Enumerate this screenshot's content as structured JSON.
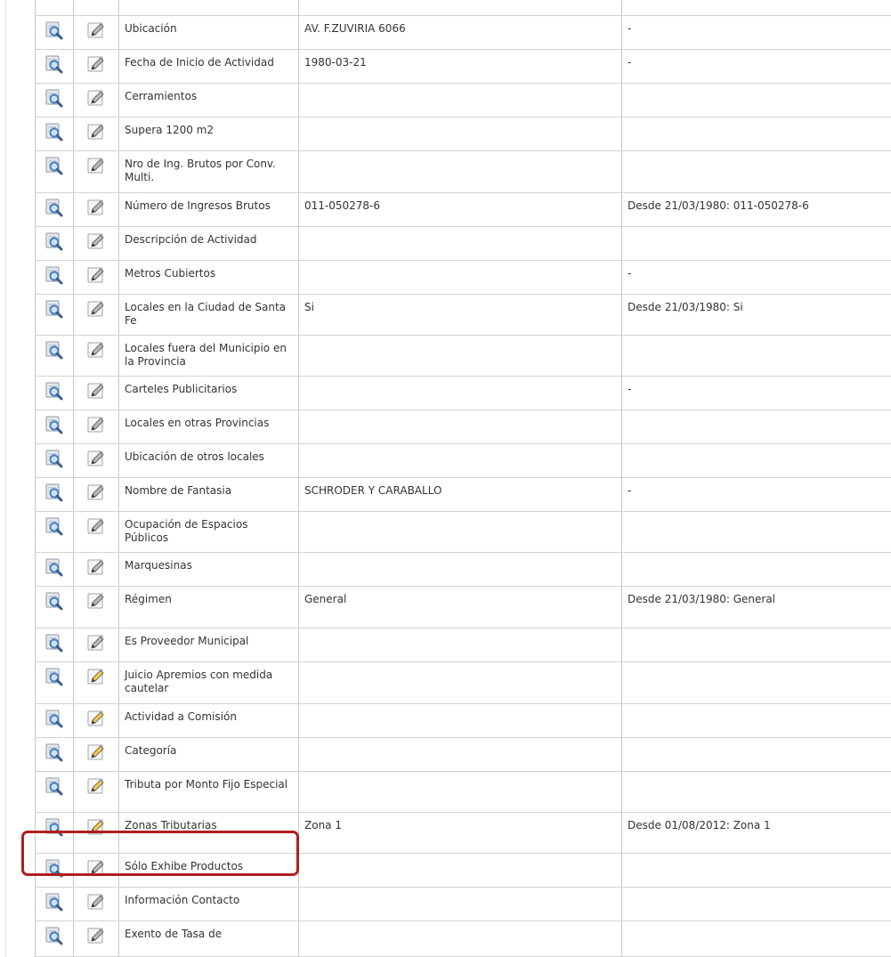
{
  "rows": [
    {
      "attribute": "Ubicación",
      "value": "AV. F.ZUVIRIA 6066",
      "history": "-",
      "edit_style": "gray"
    },
    {
      "attribute": "Fecha de Inicio de Actividad",
      "value": "1980-03-21",
      "history": "-",
      "edit_style": "gray"
    },
    {
      "attribute": "Cerramientos",
      "value": "",
      "history": "",
      "edit_style": "gray"
    },
    {
      "attribute": "Supera 1200 m2",
      "value": "",
      "history": "",
      "edit_style": "gray"
    },
    {
      "attribute": "Nro de Ing. Brutos por Conv. Multi.",
      "value": "",
      "history": "",
      "edit_style": "gray"
    },
    {
      "attribute": "Número de Ingresos Brutos",
      "value": "011-050278-6",
      "history": "Desde 21/03/1980: 011-050278-6",
      "edit_style": "gray"
    },
    {
      "attribute": "Descripción de Actividad",
      "value": "",
      "history": "",
      "edit_style": "gray"
    },
    {
      "attribute": "Metros Cubiertos",
      "value": "",
      "history": "-",
      "edit_style": "gray"
    },
    {
      "attribute": "Locales en la Ciudad de Santa Fe",
      "value": "Si",
      "history": "Desde 21/03/1980: Si",
      "edit_style": "gray"
    },
    {
      "attribute": "Locales fuera del Municipio en la Provincia",
      "value": "",
      "history": "",
      "edit_style": "gray"
    },
    {
      "attribute": "Carteles Publicitarios",
      "value": "",
      "history": "-",
      "edit_style": "gray"
    },
    {
      "attribute": "Locales en otras Provincias",
      "value": "",
      "history": "",
      "edit_style": "gray"
    },
    {
      "attribute": "Ubicación de otros locales",
      "value": "",
      "history": "",
      "edit_style": "gray"
    },
    {
      "attribute": "Nombre de Fantasia",
      "value": "SCHRODER Y CARABALLO",
      "history": "-",
      "edit_style": "gray"
    },
    {
      "attribute": "Ocupación de Espacios Públicos",
      "value": "",
      "history": "",
      "edit_style": "gray"
    },
    {
      "attribute": "Marquesinas",
      "value": "",
      "history": "",
      "edit_style": "gray"
    },
    {
      "attribute": "Régimen",
      "value": "General",
      "history": "Desde 21/03/1980: General",
      "edit_style": "gray"
    },
    {
      "attribute": "Es Proveedor Municipal",
      "value": "",
      "history": "",
      "edit_style": "gray"
    },
    {
      "attribute": "Juicio Apremios con medida cautelar",
      "value": "",
      "history": "",
      "edit_style": "yellow"
    },
    {
      "attribute": "Actividad a Comisión",
      "value": "",
      "history": "",
      "edit_style": "yellow"
    },
    {
      "attribute": "Categoría",
      "value": "",
      "history": "",
      "edit_style": "yellow"
    },
    {
      "attribute": "Tributa por Monto Fijo Especial",
      "value": "",
      "history": "",
      "edit_style": "yellow"
    },
    {
      "attribute": "Zonas Tributarias",
      "value": "Zona 1",
      "history": "Desde 01/08/2012: Zona 1",
      "edit_style": "yellow",
      "highlighted": true
    },
    {
      "attribute": "Sólo Exhibe Productos",
      "value": "",
      "history": "",
      "edit_style": "gray"
    },
    {
      "attribute": "Información Contacto",
      "value": "",
      "history": "",
      "edit_style": "gray"
    },
    {
      "attribute": "Exento de Tasa de",
      "value": "",
      "history": "",
      "edit_style": "gray"
    }
  ],
  "icons": {
    "view": "magnifier-view-icon",
    "edit": "pencil-edit-icon"
  },
  "colors": {
    "highlight_border": "#b01e1e",
    "edit_yellow": "#f2c94c",
    "edit_gray": "#b8b8b8",
    "view_blue": "#4a7fbf"
  }
}
